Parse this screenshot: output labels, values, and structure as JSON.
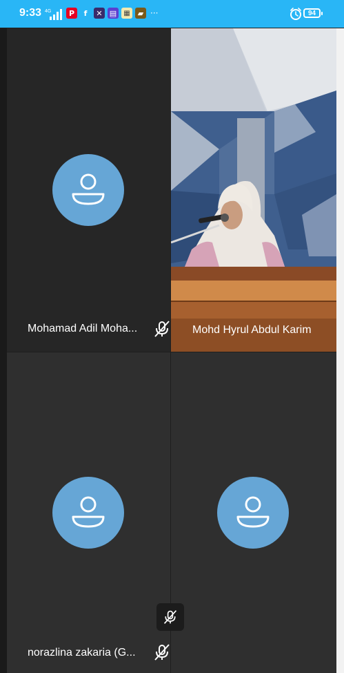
{
  "status_bar": {
    "time": "9:33",
    "network": "4G",
    "notifications": [
      "pinterest-icon",
      "facebook-icon",
      "app-icon-1",
      "app-icon-2",
      "app-icon-3",
      "app-icon-4"
    ],
    "more": "···",
    "battery": "94"
  },
  "participants": [
    {
      "name": "Mohamad Adil Moha...",
      "muted": true,
      "video": false
    },
    {
      "name": "Mohd Hyrul Abdul Karim",
      "muted": false,
      "video": true
    },
    {
      "name": "norazlina zakaria (G...",
      "muted": true,
      "video": false
    },
    {
      "name": "",
      "muted": false,
      "video": false
    }
  ],
  "colors": {
    "status_bar": "#29b6f6",
    "avatar": "#66a6d6",
    "tile_bg": "#2f2f2f"
  }
}
